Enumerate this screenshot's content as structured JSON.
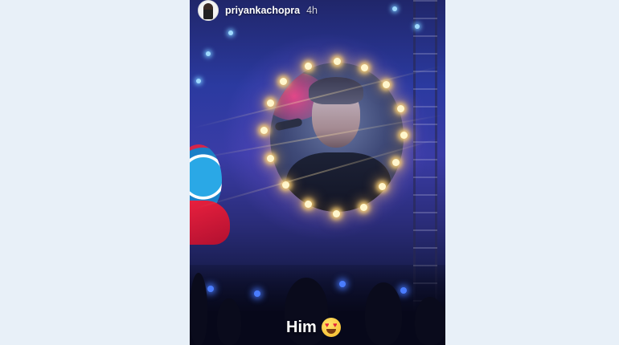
{
  "story": {
    "username": "priyankachopra",
    "timestamp": "4h",
    "caption": "Him",
    "caption_emoji": "heart-eyes-emoji",
    "avatar_icon": "profile-avatar-icon"
  },
  "colors": {
    "page_background": "#e8f0f8",
    "caption_text": "#ffffff",
    "stage_blue": "#2b3aa0",
    "bulb_glow": "#ffd678"
  }
}
